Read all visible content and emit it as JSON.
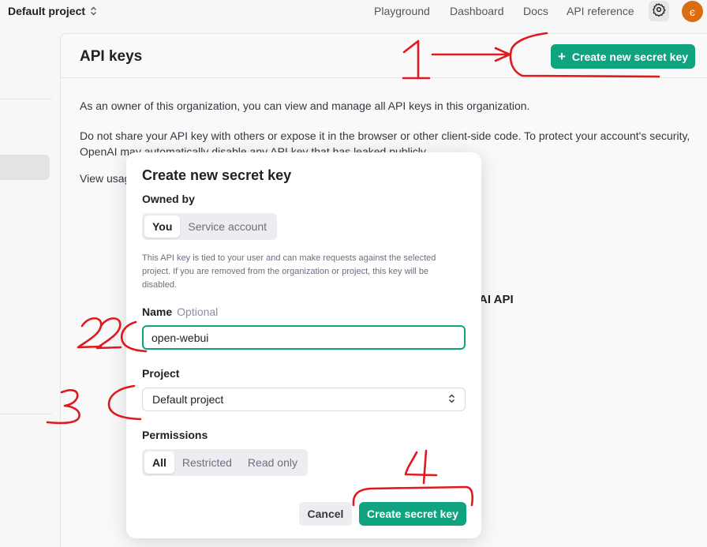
{
  "topbar": {
    "project": "Default project",
    "nav": [
      "Playground",
      "Dashboard",
      "Docs",
      "API reference"
    ],
    "avatar_letter": "є"
  },
  "page": {
    "title": "API keys",
    "create_button": "Create new secret key",
    "para1": "As an owner of this organization, you can view and manage all API keys in this organization.",
    "para2": "Do not share your API key with others or expose it in the browser or other client-side code. To protect your account's security, OpenAI may automatically disable any API key that has leaked publicly.",
    "para3": "View usag",
    "bg_text": "AI API"
  },
  "modal": {
    "title": "Create new secret key",
    "owned_by_label": "Owned by",
    "owned_by_options": [
      "You",
      "Service account"
    ],
    "owned_by_selected": "You",
    "help_text": "This API key is tied to your user and can make requests against the selected project. If you are removed from the organization or project, this key will be disabled.",
    "name_label": "Name",
    "name_optional": "Optional",
    "name_value": "open-webui",
    "project_label": "Project",
    "project_value": "Default project",
    "permissions_label": "Permissions",
    "permissions_options": [
      "All",
      "Restricted",
      "Read only"
    ],
    "permissions_selected": "All",
    "cancel_label": "Cancel",
    "create_label": "Create secret key"
  },
  "annotations": [
    "1",
    "2",
    "3",
    "4"
  ],
  "colors": {
    "accent": "#10a37f",
    "annotation": "#e0191e",
    "avatar": "#d96d0f"
  }
}
